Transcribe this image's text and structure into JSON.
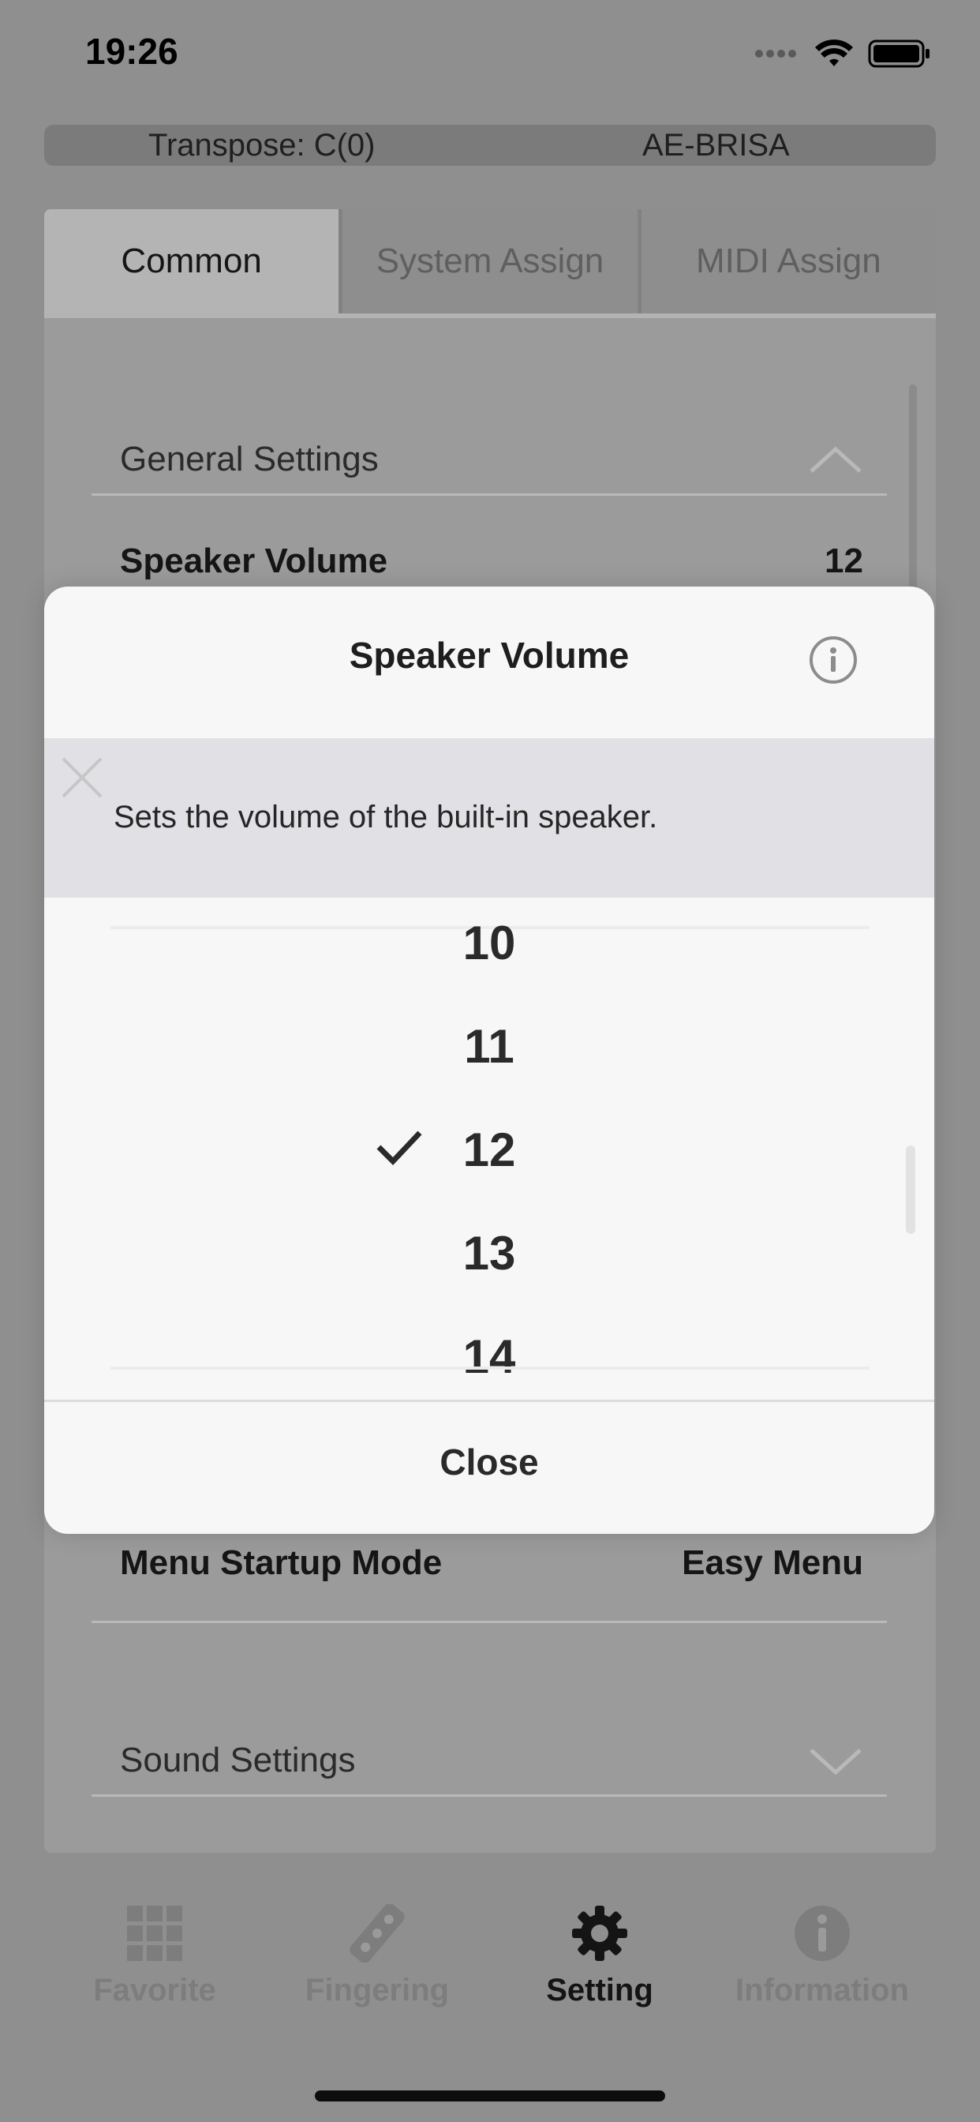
{
  "status_bar": {
    "time": "19:26"
  },
  "info_bar": {
    "transpose": "Transpose: C(0)",
    "device": "AE-BRISA"
  },
  "tabs": [
    {
      "label": "Common",
      "active": true
    },
    {
      "label": "System Assign",
      "active": false
    },
    {
      "label": "MIDI Assign",
      "active": false
    }
  ],
  "general_settings": {
    "section_label": "General Settings",
    "speaker_volume": {
      "label": "Speaker Volume",
      "value": "12"
    },
    "menu_startup": {
      "label": "Menu Startup Mode",
      "value": "Easy Menu"
    }
  },
  "sound_settings": {
    "section_label": "Sound Settings"
  },
  "modal": {
    "title": "Speaker Volume",
    "description": "Sets the volume of the built-in speaker.",
    "picker": [
      "10",
      "11",
      "12",
      "13",
      "14"
    ],
    "selected": "12",
    "close_label": "Close"
  },
  "nav": [
    {
      "label": "Favorite",
      "icon": "grid-icon",
      "active": false
    },
    {
      "label": "Fingering",
      "icon": "fingering-icon",
      "active": false
    },
    {
      "label": "Setting",
      "icon": "gear-icon",
      "active": true
    },
    {
      "label": "Information",
      "icon": "info-icon",
      "active": false
    }
  ],
  "colors": {
    "overlay": "#8f8f8f",
    "modal_bg": "#f7f7f7",
    "description_band": "#e1e1e5"
  }
}
